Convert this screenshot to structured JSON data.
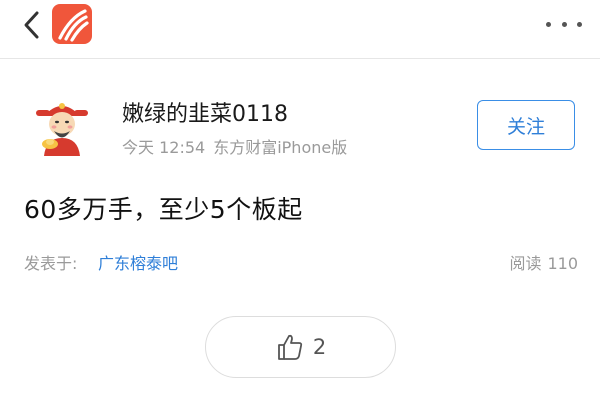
{
  "header": {
    "back_icon": "chevron-left-icon",
    "app_logo_icon": "eastmoney-logo-icon",
    "app_logo_color": "#f0563b",
    "more_icon": "more-dots-icon"
  },
  "post": {
    "author": {
      "name": "嫩绿的韭菜0118",
      "avatar_icon": "caishen-avatar-icon"
    },
    "time": "今天 12:54",
    "source": "东方财富iPhone版",
    "follow_label": "关注",
    "body": "60多万手，至少5个板起",
    "posted_in_prefix": "发表于:",
    "board_name": "广东榕泰吧",
    "reads_label": "阅读",
    "reads_count": "110",
    "likes": {
      "icon": "thumbs-up-icon",
      "count": "2"
    }
  },
  "colors": {
    "accent": "#2f7fd8",
    "muted_text": "#9a9a9a"
  }
}
